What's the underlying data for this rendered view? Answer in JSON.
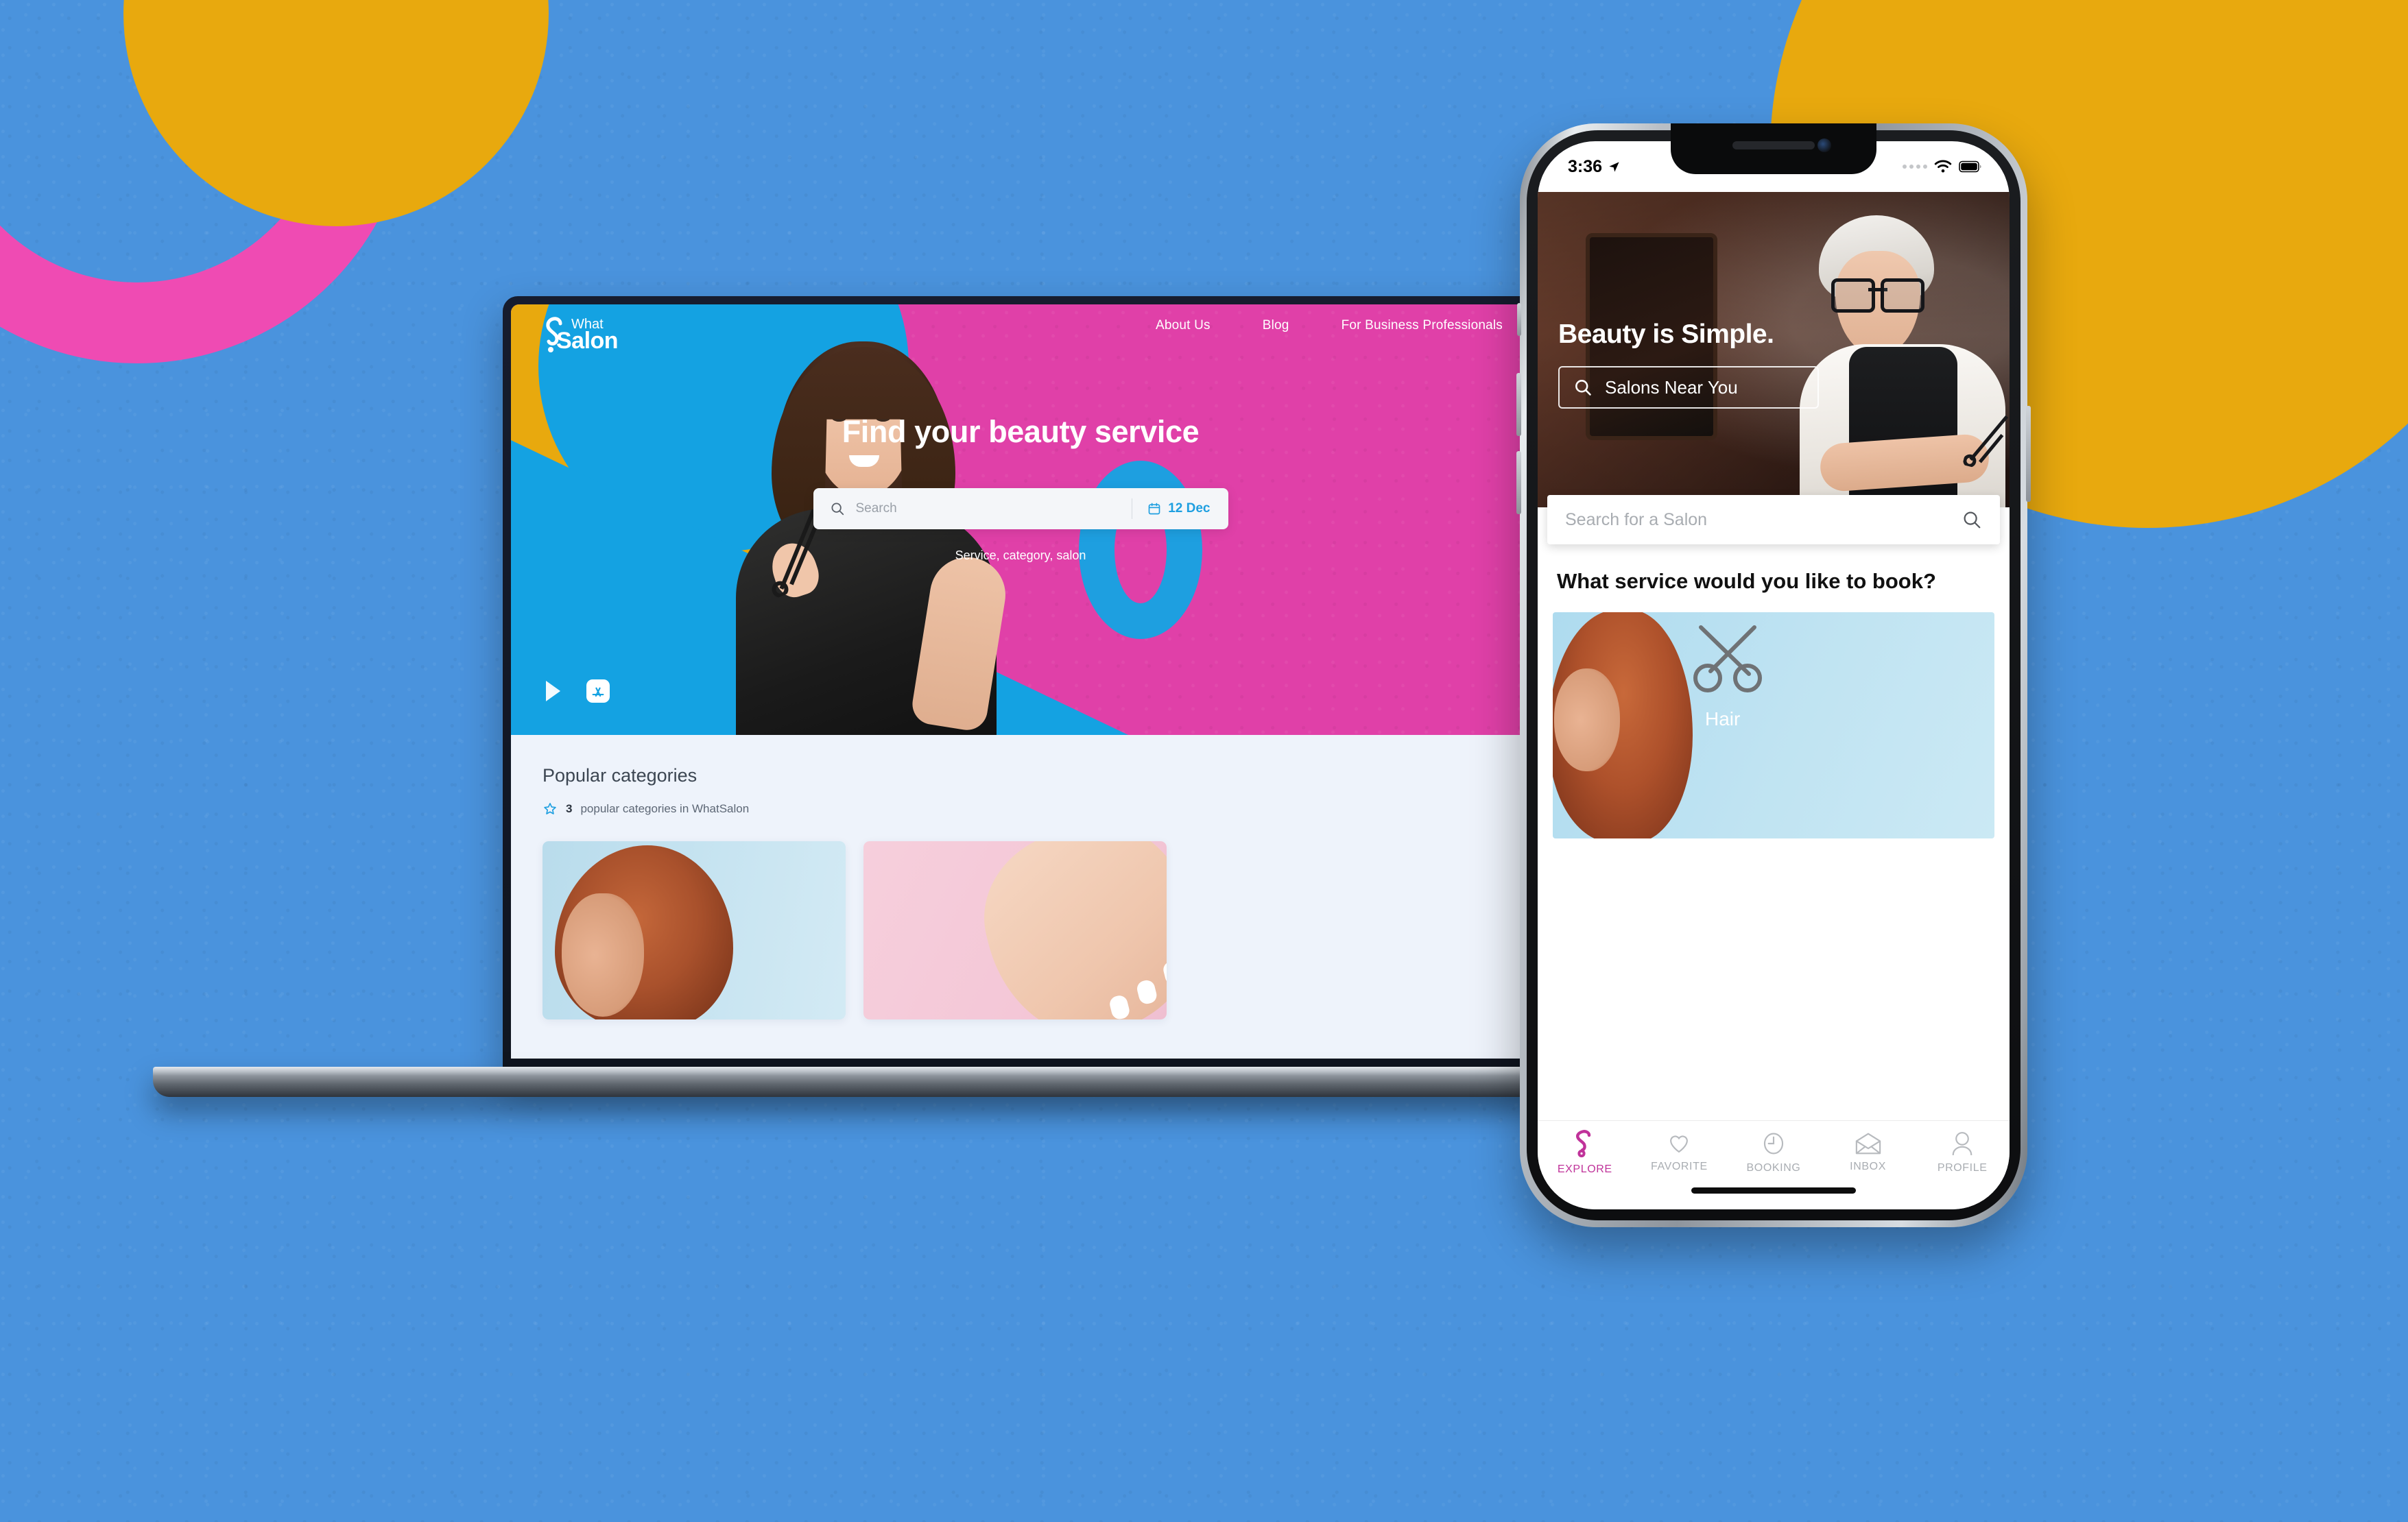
{
  "background": {
    "base_color": "#4a93dd",
    "shapes": [
      {
        "name": "pink-ring",
        "color": "#ef4bb3"
      },
      {
        "name": "yellow-circle-top-left",
        "color": "#e8a90e"
      },
      {
        "name": "yellow-circle-top-right",
        "color": "#e8a90e"
      }
    ]
  },
  "laptop": {
    "brand": {
      "logo_word_top": "What",
      "logo_word_main": "Salon"
    },
    "nav": [
      {
        "label": "About Us"
      },
      {
        "label": "Blog"
      },
      {
        "label": "For Business Professionals"
      }
    ],
    "hero": {
      "title": "Find your beauty service",
      "search_placeholder": "Search",
      "date_value": "12 Dec",
      "subtitle": "Service, category, salon",
      "accent_pink": "#e040a8",
      "accent_blue": "#14a2e2",
      "accent_yellow": "#e8a90e",
      "store_badges": [
        {
          "name": "google-play-badge"
        },
        {
          "name": "app-store-badge"
        }
      ]
    },
    "categories": {
      "heading": "Popular categories",
      "count": "3",
      "count_suffix": "popular categories in WhatSalon",
      "cards": [
        {
          "name": "hair-category-card",
          "bg": "#c1e0ef"
        },
        {
          "name": "nails-category-card",
          "bg": "#f4c9d9"
        }
      ]
    }
  },
  "phone": {
    "status_bar": {
      "time": "3:36",
      "location_icon": "location-arrow-icon",
      "signal_icon": "signal-dots-icon",
      "wifi_icon": "wifi-icon",
      "battery_icon": "battery-icon"
    },
    "hero": {
      "title": "Beauty is Simple.",
      "search_button_label": "Salons Near You"
    },
    "search": {
      "placeholder": "Search for a Salon"
    },
    "question": "What service would you like to book?",
    "service_card": {
      "label": "Hair",
      "icon": "scissors-icon"
    },
    "tabbar": {
      "active_color": "#c0339a",
      "inactive_color": "#a9adb2",
      "items": [
        {
          "label": "EXPLORE",
          "icon": "whatsalon-logo-icon",
          "active": true
        },
        {
          "label": "FAVORITE",
          "icon": "heart-icon",
          "active": false
        },
        {
          "label": "BOOKING",
          "icon": "clock-icon",
          "active": false
        },
        {
          "label": "INBOX",
          "icon": "envelope-icon",
          "active": false
        },
        {
          "label": "PROFILE",
          "icon": "person-icon",
          "active": false
        }
      ]
    }
  }
}
